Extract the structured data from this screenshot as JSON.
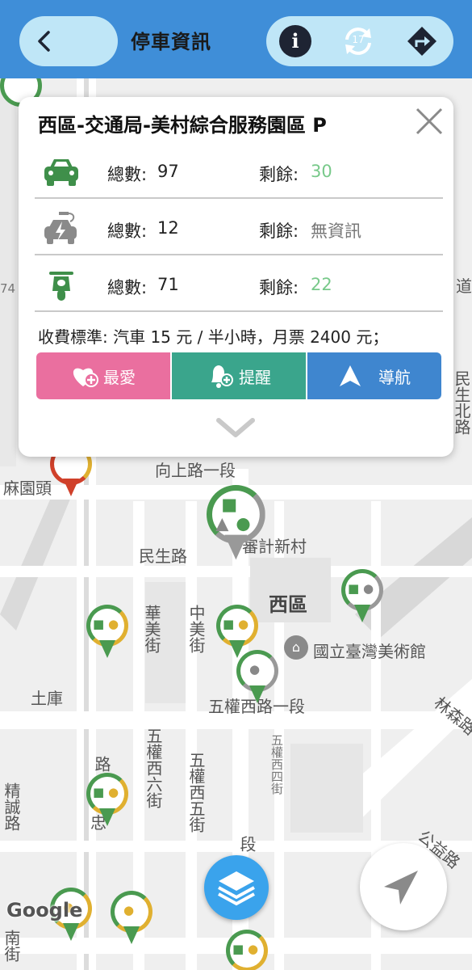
{
  "header": {
    "title": "停車資訊",
    "back_icon": "chevron-left-icon",
    "info_icon_text": "i",
    "refresh_count": "17",
    "accent": "#3f8ed8"
  },
  "card": {
    "title": "西區-交通局-美村綜合服務園區 P",
    "rows": [
      {
        "icon": "car-icon",
        "total_label": "總數:",
        "total": "97",
        "remain_label": "剩餘:",
        "remain": "30",
        "remain_color": "green"
      },
      {
        "icon": "electric-car-icon",
        "total_label": "總數:",
        "total": "12",
        "remain_label": "剩餘:",
        "remain": "無資訊",
        "remain_color": "grey"
      },
      {
        "icon": "scooter-icon",
        "total_label": "總數:",
        "total": "71",
        "remain_label": "剩餘:",
        "remain": "22",
        "remain_color": "green"
      }
    ],
    "fee": "收費標準: 汽車 15 元 / 半小時，月票 2400 元；",
    "actions": {
      "favorite": "最愛",
      "remind": "提醒",
      "navigate": "導航"
    }
  },
  "map": {
    "labels": {
      "mayuantou": "麻園頭",
      "xiangshang": "向上路一段",
      "minsheng": "民生路",
      "shenji": "審計新村",
      "xiqu": "西區",
      "museum": "國立臺灣美術館",
      "huamei": "華美街",
      "zhongmei": "中美街",
      "tuku": "土庫",
      "wuquanxi1": "五權西路一段",
      "wuquanxi6": "五權西六街",
      "wuquanxi5": "五權西五街",
      "wuquanxi4": "五權西四街",
      "minsheng_n": "民生北路",
      "dao": "道",
      "lin": "林森路",
      "gongyi": "公益路",
      "jingcheng": "精誠路",
      "zhong": "忠",
      "lu": "路",
      "duan": "段",
      "nan": "南街",
      "num": "74"
    },
    "google": "Google"
  }
}
